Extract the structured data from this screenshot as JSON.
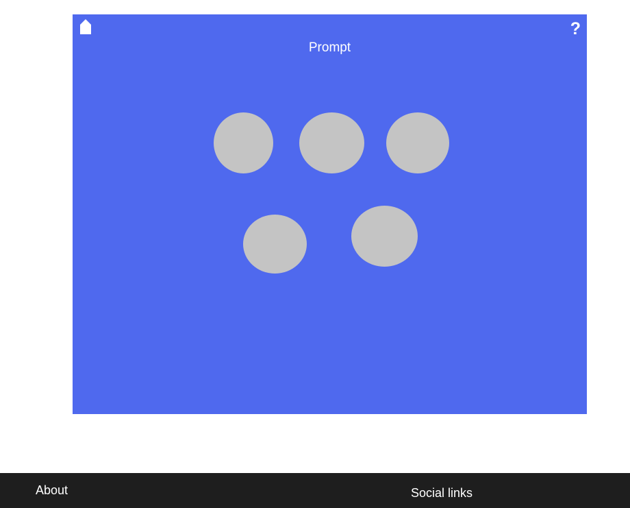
{
  "stage": {
    "background_color": "#4f69ee",
    "home_icon": "home-icon",
    "help_label": "?",
    "prompt": "Prompt",
    "choices": [
      {
        "color": "#c4c4c4"
      },
      {
        "color": "#c4c4c4"
      },
      {
        "color": "#c4c4c4"
      },
      {
        "color": "#c4c4c4"
      },
      {
        "color": "#c4c4c4"
      }
    ]
  },
  "footer": {
    "background_color": "#1e1e1e",
    "about_label": "About",
    "social_label": "Social links"
  }
}
